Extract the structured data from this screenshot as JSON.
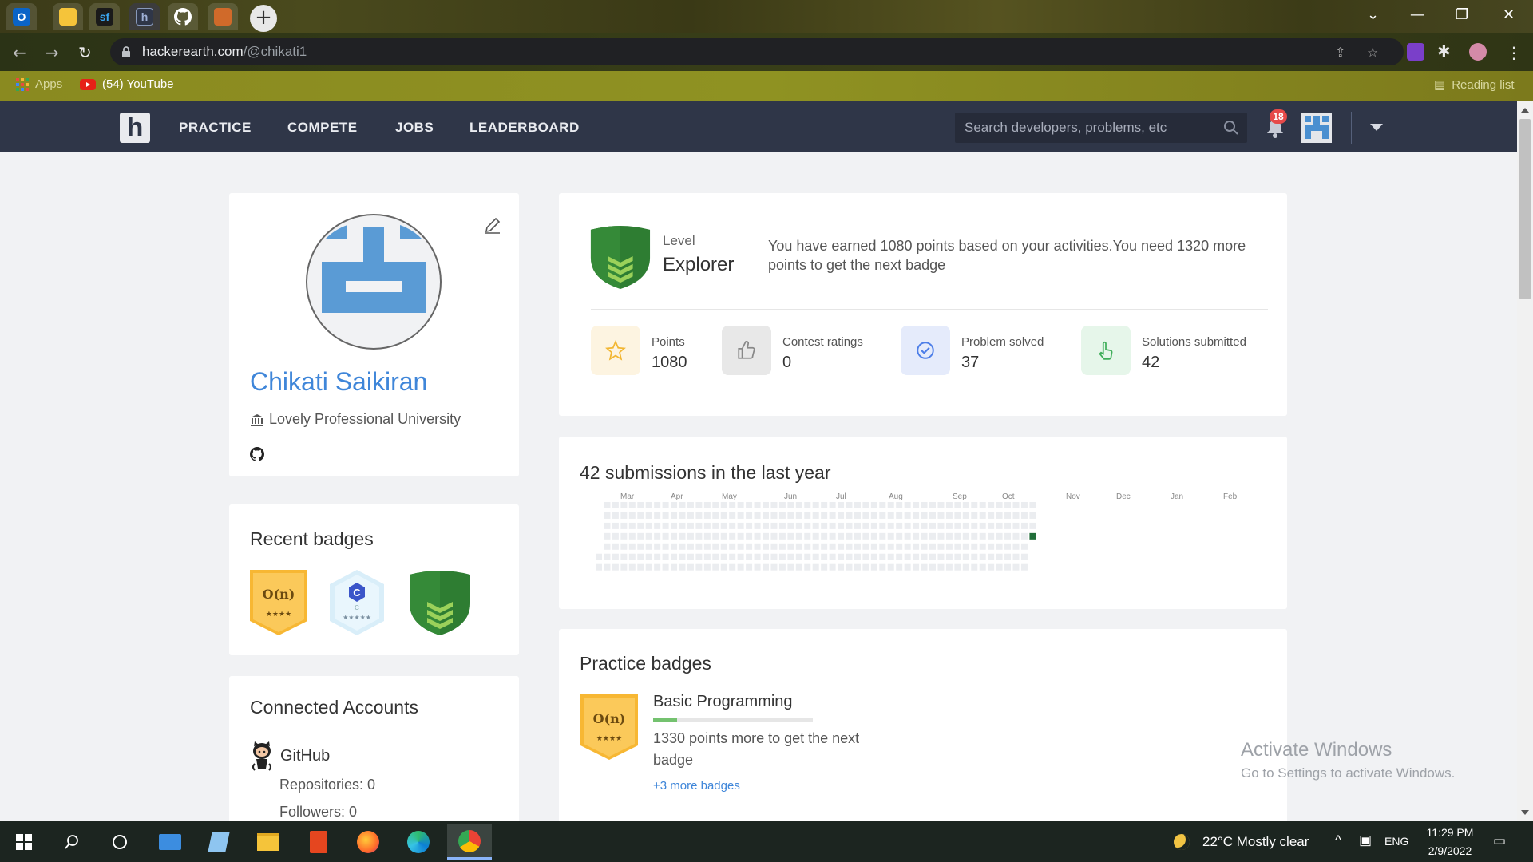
{
  "browser": {
    "url_host": "hackerearth.com",
    "url_path": "/@chikati1",
    "bookmarks": [
      {
        "label": "Apps"
      },
      {
        "label": "(54) YouTube"
      }
    ],
    "reading_list": "Reading list",
    "tabs": [
      {
        "icon": "outlook-icon",
        "color": "#0a64c8"
      },
      {
        "icon": "folder-icon",
        "color": "#f5c43a"
      },
      {
        "icon": "sf-icon",
        "color": "#1a1a1a",
        "text": "sf"
      },
      {
        "icon": "hackerearth-icon",
        "color": "#2f3648",
        "text": "h"
      },
      {
        "icon": "github-icon",
        "color": "#222"
      },
      {
        "icon": "chart-tab-icon",
        "color": "#d06a2a"
      }
    ]
  },
  "sitenav": {
    "logo": "h",
    "links": [
      "PRACTICE",
      "COMPETE",
      "JOBS",
      "LEADERBOARD"
    ],
    "search_placeholder": "Search developers, problems, etc",
    "notifications": "18"
  },
  "profile": {
    "name": "Chikati Saikiran",
    "university": "Lovely Professional University"
  },
  "badges_card": {
    "title": "Recent badges",
    "badges": [
      {
        "text": "O(n)",
        "stars": "★★★★",
        "color": "#f7b733"
      },
      {
        "text": "C",
        "sub": "C",
        "stars": "★★★★★",
        "color": "#d9eef9"
      },
      {
        "text": "",
        "color": "#2e7d32"
      }
    ]
  },
  "accounts_card": {
    "title": "Connected Accounts",
    "service": "GitHub",
    "lines": [
      "Repositories: 0",
      "Followers: 0"
    ]
  },
  "level": {
    "label": "Level",
    "name": "Explorer",
    "message": "You have earned 1080 points based on your activities.You need 1320 more points to get the next badge"
  },
  "stats": [
    {
      "label": "Points",
      "value": "1080",
      "icon": "star-icon",
      "bg": "#fdf4e1",
      "fg": "#f2b632"
    },
    {
      "label": "Contest ratings",
      "value": "0",
      "icon": "thumbs-up-icon",
      "bg": "#e8e8e8",
      "fg": "#888888"
    },
    {
      "label": "Problem solved",
      "value": "37",
      "icon": "check-badge-icon",
      "bg": "#e5ebfb",
      "fg": "#4d7ee8"
    },
    {
      "label": "Solutions submitted",
      "value": "42",
      "icon": "pointer-hand-icon",
      "bg": "#e6f6ea",
      "fg": "#3fae5a"
    }
  ],
  "submissions": {
    "title": "42 submissions in the last year",
    "months": [
      "Mar",
      "Apr",
      "May",
      "Jun",
      "Jul",
      "Aug",
      "Sep",
      "Oct",
      "Nov",
      "Dec",
      "Jan",
      "Feb"
    ],
    "empty_color": "#ebedf0",
    "active_color": "#216e39"
  },
  "practice": {
    "title": "Practice badges",
    "badge_text": "O(n)",
    "badge_stars": "★★★★",
    "topic": "Basic Programming",
    "progress_fraction": 0.15,
    "message": "1330 points more to get the next badge",
    "more": "+3 more badges"
  },
  "watermark": {
    "line1": "Activate Windows",
    "line2": "Go to Settings to activate Windows."
  },
  "taskbar": {
    "weather": "22°C  Mostly clear",
    "lang": "ENG",
    "time": "11:29 PM",
    "date": "2/9/2022"
  }
}
